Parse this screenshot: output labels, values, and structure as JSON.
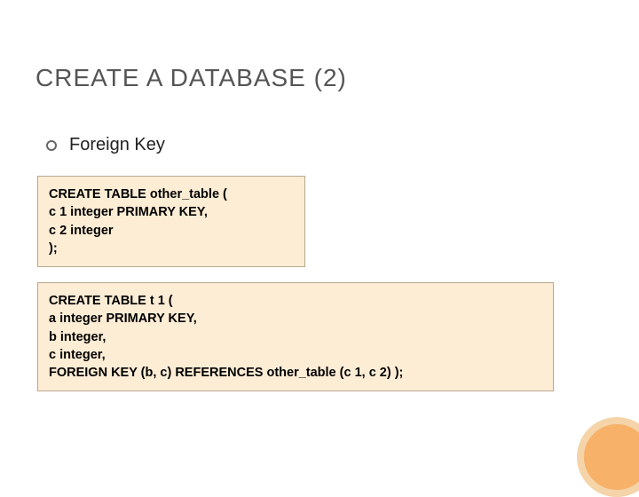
{
  "title": "CREATE A DATABASE (2)",
  "subtitle": "Foreign Key",
  "code1": "CREATE TABLE other_table (\nc 1 integer PRIMARY KEY,\nc 2 integer\n);",
  "code2": "CREATE TABLE t 1 (\na integer PRIMARY KEY,\nb integer,\nc integer,\nFOREIGN KEY (b, c) REFERENCES other_table (c 1, c 2) );"
}
